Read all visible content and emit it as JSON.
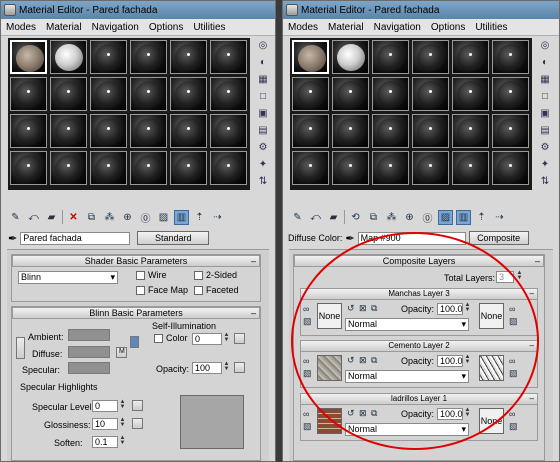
{
  "left": {
    "title": "Material Editor - Pared fachada",
    "menu": [
      "Modes",
      "Material",
      "Navigation",
      "Options",
      "Utilities"
    ],
    "material_name": "Pared fachada",
    "material_type_button": "Standard",
    "shader_rollout": "Shader Basic Parameters",
    "shader_type": "Blinn",
    "wire": "Wire",
    "two_sided": "2-Sided",
    "face_map": "Face Map",
    "faceted": "Faceted",
    "blinn_rollout": "Blinn Basic Parameters",
    "self_illum_group": "Self-Illumination",
    "color_label": "Color",
    "color_value": "0",
    "ambient": "Ambient:",
    "diffuse": "Diffuse:",
    "specular": "Specular:",
    "m_button": "M",
    "opacity_label": "Opacity:",
    "opacity_value": "100",
    "spec_highlights": "Specular Highlights",
    "spec_level_label": "Specular Level:",
    "spec_level_value": "0",
    "glossiness_label": "Glossiness:",
    "glossiness_value": "10",
    "soften_label": "Soften:",
    "soften_value": "0.1"
  },
  "right": {
    "title": "Material Editor - Pared fachada",
    "menu": [
      "Modes",
      "Material",
      "Navigation",
      "Options",
      "Utilities"
    ],
    "diffuse_label": "Diffuse Color:",
    "map_name": "Map #900",
    "map_type_button": "Composite",
    "composite_rollout": "Composite Layers",
    "total_layers_label": "Total Layers:",
    "total_layers_value": "3",
    "layers": [
      {
        "header": "Manchas Layer 3",
        "left_map": "None",
        "right_map": "None",
        "opacity_label": "Opacity:",
        "opacity": "100.0",
        "blend": "Normal"
      },
      {
        "header": "Cemento Layer 2",
        "opacity_label": "Opacity:",
        "opacity": "100.0",
        "blend": "Normal"
      },
      {
        "header": "ladrillos Layer 1",
        "right_map": "None",
        "opacity_label": "Opacity:",
        "opacity": "100.0",
        "blend": "Normal"
      }
    ]
  },
  "colors": {
    "annotation": "#e10000",
    "titlebar": "#6f97bd"
  }
}
